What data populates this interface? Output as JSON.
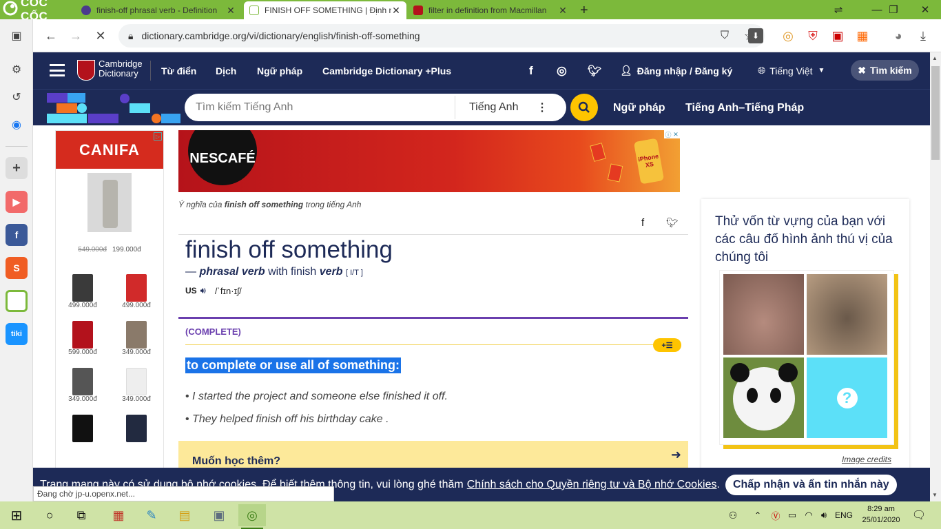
{
  "browser": {
    "brand": "CỐC CỐC",
    "tabs": [
      {
        "title": "finish-off phrasal verb - Definition"
      },
      {
        "title": "FINISH OFF SOMETHING | Định ng"
      },
      {
        "title": "filter in definition from Macmillan"
      }
    ],
    "url": "dictionary.cambridge.org/vi/dictionary/english/finish-off-something",
    "status": "Đang chờ jp-u.openx.net..."
  },
  "site": {
    "logo_line1": "Cambridge",
    "logo_line2": "Dictionary",
    "nav": [
      "Từ điển",
      "Dịch",
      "Ngữ pháp",
      "Cambridge Dictionary +Plus"
    ],
    "login": "Đăng nhập / Đăng ký",
    "language": "Tiếng Việt",
    "search_button": "Tìm kiếm",
    "search_placeholder": "Tìm kiếm Tiếng Anh",
    "search_lang": "Tiếng Anh",
    "sub_links": [
      "Ngữ pháp",
      "Tiếng Anh–Tiếng Pháp"
    ]
  },
  "left_ad": {
    "brand": "CANIFA",
    "old_price": "549.000đ",
    "new_price": "199.000đ",
    "products": [
      {
        "price": "499.000đ",
        "color": "#3a3a3a"
      },
      {
        "price": "499.000đ",
        "color": "#d12a2a"
      },
      {
        "price": "599.000đ",
        "color": "#b3121c"
      },
      {
        "price": "349.000đ",
        "color": "#8a7a6a"
      },
      {
        "price": "349.000đ",
        "color": "#555555"
      },
      {
        "price": "349.000đ",
        "color": "#eeeeee"
      },
      {
        "price": "",
        "color": "#111111"
      },
      {
        "price": "",
        "color": "#222a40"
      }
    ]
  },
  "banner": {
    "brand": "NESCAFÉ",
    "phone_label": "iPhone XS"
  },
  "entry": {
    "meaning_prefix": "Ý nghĩa của",
    "meaning_word": "finish off something",
    "meaning_suffix": "trong tiếng Anh",
    "headword": "finish off something",
    "dash": "—",
    "pos": "phrasal verb",
    "with_text": "with finish",
    "verb": "verb",
    "grammar": "[ I/T ]",
    "region": "US",
    "pron": "/ˈfɪn·ɪʃ/",
    "guide": "(COMPLETE)",
    "definition": "to complete or use all of something:",
    "examples": [
      "I started the project and someone else finished it off.",
      "They helped finish off his birthday cake ."
    ],
    "learn_more": "Muốn học thêm?"
  },
  "quiz": {
    "text": "Thử vốn từ vựng của bạn với các câu đố hình ảnh thú vị của chúng tôi",
    "credits": "Image credits"
  },
  "cookie": {
    "text": "Trang mạng này có sử dụng bộ nhớ cookies. Để biết thêm thông tin, vui lòng ghé thăm",
    "link": "Chính sách cho Quyền riêng tư và Bộ nhớ Cookies",
    "button": "Chấp nhận và ẩn tin nhắn này"
  },
  "taskbar": {
    "time": "8:29 am",
    "date": "25/01/2020",
    "lang": "ENG"
  },
  "colors": {
    "navy": "#1d2a57",
    "highlight": "#1a73e8",
    "accent": "#fec400",
    "green": "#7cb93b"
  }
}
